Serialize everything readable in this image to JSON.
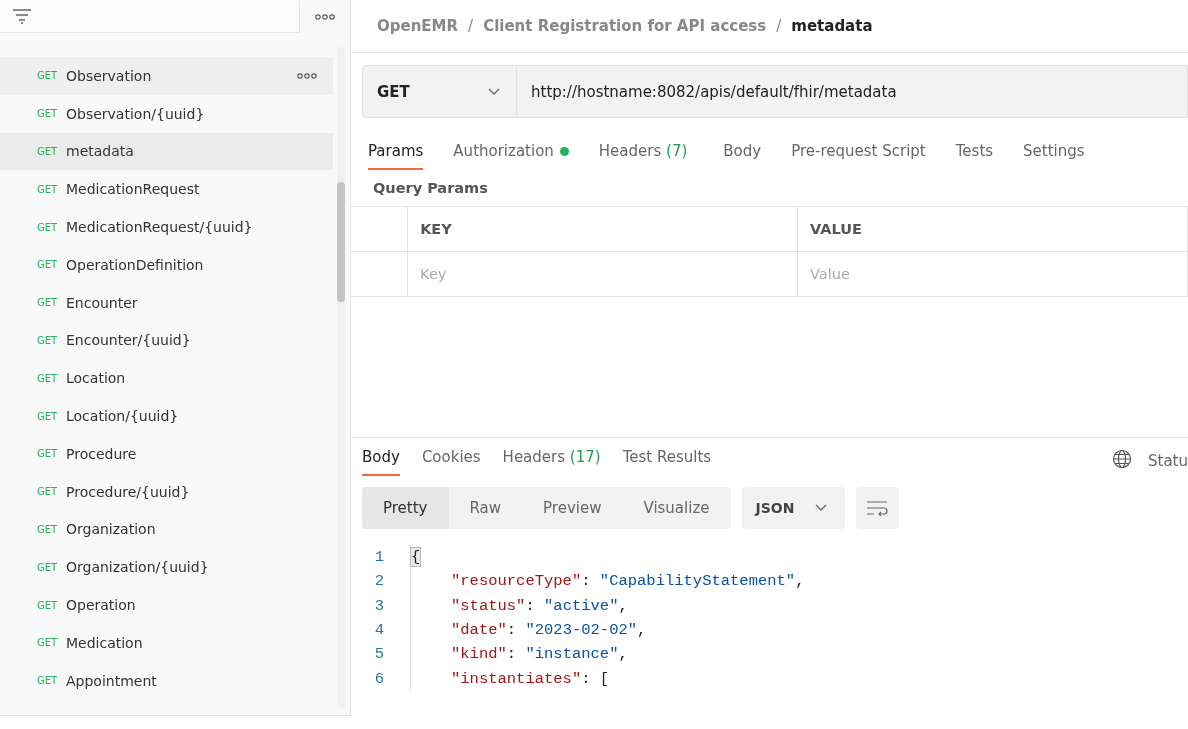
{
  "sidebar": {
    "items": [
      {
        "method": "GET",
        "name": "Observation",
        "selected": false,
        "hovered": true
      },
      {
        "method": "GET",
        "name": "Observation/{uuid}",
        "selected": false,
        "hovered": false
      },
      {
        "method": "GET",
        "name": "metadata",
        "selected": true,
        "hovered": false
      },
      {
        "method": "GET",
        "name": "MedicationRequest",
        "selected": false,
        "hovered": false
      },
      {
        "method": "GET",
        "name": "MedicationRequest/{uuid}",
        "selected": false,
        "hovered": false
      },
      {
        "method": "GET",
        "name": "OperationDefinition",
        "selected": false,
        "hovered": false
      },
      {
        "method": "GET",
        "name": "Encounter",
        "selected": false,
        "hovered": false
      },
      {
        "method": "GET",
        "name": "Encounter/{uuid}",
        "selected": false,
        "hovered": false
      },
      {
        "method": "GET",
        "name": "Location",
        "selected": false,
        "hovered": false
      },
      {
        "method": "GET",
        "name": "Location/{uuid}",
        "selected": false,
        "hovered": false
      },
      {
        "method": "GET",
        "name": "Procedure",
        "selected": false,
        "hovered": false
      },
      {
        "method": "GET",
        "name": "Procedure/{uuid}",
        "selected": false,
        "hovered": false
      },
      {
        "method": "GET",
        "name": "Organization",
        "selected": false,
        "hovered": false
      },
      {
        "method": "GET",
        "name": "Organization/{uuid}",
        "selected": false,
        "hovered": false
      },
      {
        "method": "GET",
        "name": "Operation",
        "selected": false,
        "hovered": false
      },
      {
        "method": "GET",
        "name": "Medication",
        "selected": false,
        "hovered": false
      },
      {
        "method": "GET",
        "name": "Appointment",
        "selected": false,
        "hovered": false
      }
    ]
  },
  "breadcrumb": [
    "OpenEMR",
    "Client Registration for API access",
    "metadata"
  ],
  "breadcrumb_separator": "/",
  "request": {
    "method": "GET",
    "url": "http://hostname:8082/apis/default/fhir/metadata"
  },
  "request_tabs": [
    {
      "label": "Params",
      "selected": true
    },
    {
      "label": "Authorization",
      "selected": false,
      "dot": true
    },
    {
      "label": "Headers",
      "count": "(7)",
      "selected": false
    },
    {
      "label": "Body",
      "selected": false
    },
    {
      "label": "Pre-request Script",
      "selected": false
    },
    {
      "label": "Tests",
      "selected": false
    },
    {
      "label": "Settings",
      "selected": false
    }
  ],
  "query_params": {
    "title": "Query Params",
    "columns": [
      "KEY",
      "VALUE"
    ],
    "placeholders": [
      "Key",
      "Value"
    ]
  },
  "response_tabs": [
    {
      "label": "Body",
      "selected": true
    },
    {
      "label": "Cookies",
      "selected": false
    },
    {
      "label": "Headers",
      "count": "(17)",
      "selected": false
    },
    {
      "label": "Test Results",
      "selected": false
    }
  ],
  "status_label": "Statu",
  "view_modes": [
    {
      "label": "Pretty",
      "selected": true
    },
    {
      "label": "Raw",
      "selected": false
    },
    {
      "label": "Preview",
      "selected": false
    },
    {
      "label": "Visualize",
      "selected": false
    }
  ],
  "format": "JSON",
  "code": [
    {
      "number": "1",
      "tokens": [
        {
          "kind": "brace",
          "text": "{"
        }
      ]
    },
    {
      "number": "2",
      "tokens": [
        {
          "kind": "key",
          "text": "\"resourceType\""
        },
        {
          "kind": "punct",
          "text": ": "
        },
        {
          "kind": "string",
          "text": "\"CapabilityStatement\""
        },
        {
          "kind": "punct",
          "text": ","
        }
      ]
    },
    {
      "number": "3",
      "tokens": [
        {
          "kind": "key",
          "text": "\"status\""
        },
        {
          "kind": "punct",
          "text": ": "
        },
        {
          "kind": "string",
          "text": "\"active\""
        },
        {
          "kind": "punct",
          "text": ","
        }
      ]
    },
    {
      "number": "4",
      "tokens": [
        {
          "kind": "key",
          "text": "\"date\""
        },
        {
          "kind": "punct",
          "text": ": "
        },
        {
          "kind": "string",
          "text": "\"2023-02-02\""
        },
        {
          "kind": "punct",
          "text": ","
        }
      ]
    },
    {
      "number": "5",
      "tokens": [
        {
          "kind": "key",
          "text": "\"kind\""
        },
        {
          "kind": "punct",
          "text": ": "
        },
        {
          "kind": "string",
          "text": "\"instance\""
        },
        {
          "kind": "punct",
          "text": ","
        }
      ]
    },
    {
      "number": "6",
      "tokens": [
        {
          "kind": "key",
          "text": "\"instantiates\""
        },
        {
          "kind": "punct",
          "text": ": ["
        }
      ]
    }
  ]
}
